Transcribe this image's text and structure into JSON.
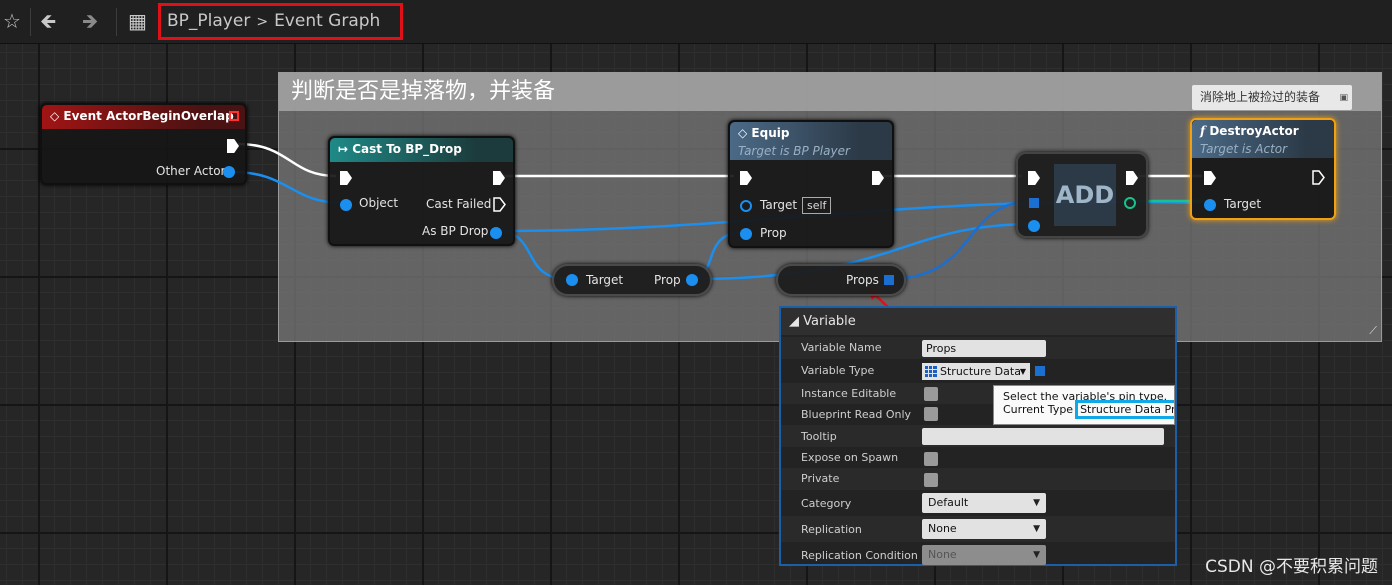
{
  "toolbar": {
    "star": "☆",
    "back": "🡸",
    "forward": "🡺",
    "graph_icon": "▦"
  },
  "breadcrumb": {
    "blueprint": "BP_Player",
    "separator": ">",
    "graph": "Event Graph"
  },
  "comment_box": {
    "title": "判断是否是掉落物，并装备",
    "bubble": "消除地上被捡过的装备"
  },
  "nodes": {
    "event": {
      "title": "Event ActorBeginOverlap",
      "pin_other_actor": "Other Actor"
    },
    "cast": {
      "title": "Cast To BP_Drop",
      "pin_object": "Object",
      "pin_cast_failed": "Cast Failed",
      "pin_as": "As BP Drop"
    },
    "equip": {
      "title": "Equip",
      "subtitle": "Target is BP Player",
      "pin_target": "Target",
      "self": "self",
      "pin_prop": "Prop"
    },
    "get_prop": {
      "pin_target": "Target",
      "pin_prop": "Prop"
    },
    "props_var": {
      "label": "Props"
    },
    "add": {
      "label": "ADD"
    },
    "destroy": {
      "title": "DestroyActor",
      "subtitle": "Target is Actor",
      "pin_target": "Target"
    }
  },
  "details": {
    "category": "Variable",
    "rows": {
      "variable_name": {
        "label": "Variable Name",
        "value": "Props"
      },
      "variable_type": {
        "label": "Variable Type",
        "value": "Structure Data"
      },
      "instance_editable": {
        "label": "Instance Editable"
      },
      "blueprint_read_only": {
        "label": "Blueprint Read Only"
      },
      "tooltip": {
        "label": "Tooltip",
        "value": ""
      },
      "expose_on_spawn": {
        "label": "Expose on Spawn"
      },
      "private": {
        "label": "Private"
      },
      "category": {
        "label": "Category",
        "value": "Default"
      },
      "replication": {
        "label": "Replication",
        "value": "None"
      },
      "replication_condition": {
        "label": "Replication Condition",
        "value": "None"
      }
    },
    "tooltip": {
      "line1": "Select the variable's pin type.",
      "line2_prefix": "Current Type",
      "line2_value": "Structure Data Prop"
    }
  },
  "watermark": "CSDN @不要积累问题",
  "colors": {
    "exec_wire": "#ffffff",
    "object_wire": "#1a8ff0",
    "highlight": "#e01018",
    "selected_node": "#f0a010"
  }
}
